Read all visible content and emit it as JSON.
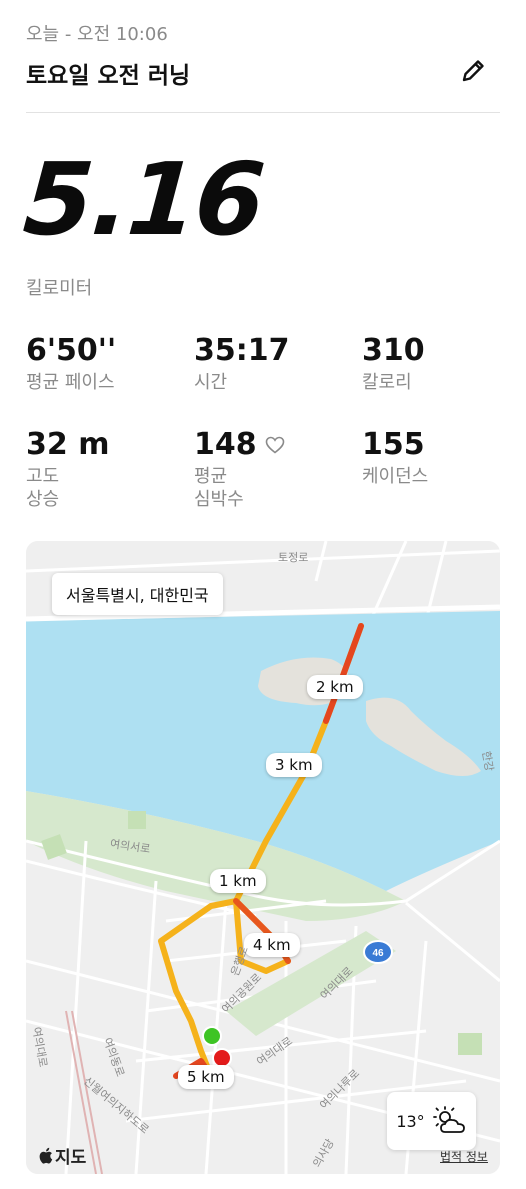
{
  "header": {
    "date": "오늘 - 오전 10:06",
    "title": "토요일 오전 러닝",
    "edit_icon": "pencil-icon"
  },
  "summary": {
    "distance": "5.16",
    "distance_unit": "킬로미터"
  },
  "stats": {
    "pace": {
      "value": "6'50''",
      "label": "평균 페이스"
    },
    "time": {
      "value": "35:17",
      "label": "시간"
    },
    "calories": {
      "value": "310",
      "label": "칼로리"
    },
    "elevation": {
      "value": "32 m",
      "label": "고도\n상승"
    },
    "heart_rate": {
      "value": "148",
      "label": "평균\n심박수",
      "icon": "heart-outline-icon"
    },
    "cadence": {
      "value": "155",
      "label": "케이던스"
    }
  },
  "map": {
    "location": "서울특별시, 대한민국",
    "km_markers": [
      "1 km",
      "2 km",
      "3 km",
      "4 km",
      "5 km"
    ],
    "road_labels": {
      "tojeong": "토정로",
      "yeouiseoro": "여의서로",
      "hangang": "한강",
      "eunhaeng": "은행로",
      "yeouigongwon": "여의공원로",
      "yeouidaero_1": "여의대로",
      "yeouidaero_2": "여의대로",
      "yeouidongro": "여의동로",
      "yeouinaru": "여의나루로",
      "uisadang": "의사당",
      "sinwolyeoui": "신월여의지하도로",
      "yeouidaero_left": "여의대로",
      "route_shield": "46"
    },
    "weather": {
      "temp": "13°",
      "icon": "partly-sunny-icon"
    },
    "brand": "지도",
    "brand_icon": "apple-logo-icon",
    "legal": "법적 정보",
    "colors": {
      "water": "#aee0f2",
      "land": "#efefef",
      "park": "#d6e8cd",
      "route_yellow": "#f5b21b",
      "route_red": "#e4461f",
      "start": "#3ec424",
      "end": "#e31b1b"
    }
  }
}
